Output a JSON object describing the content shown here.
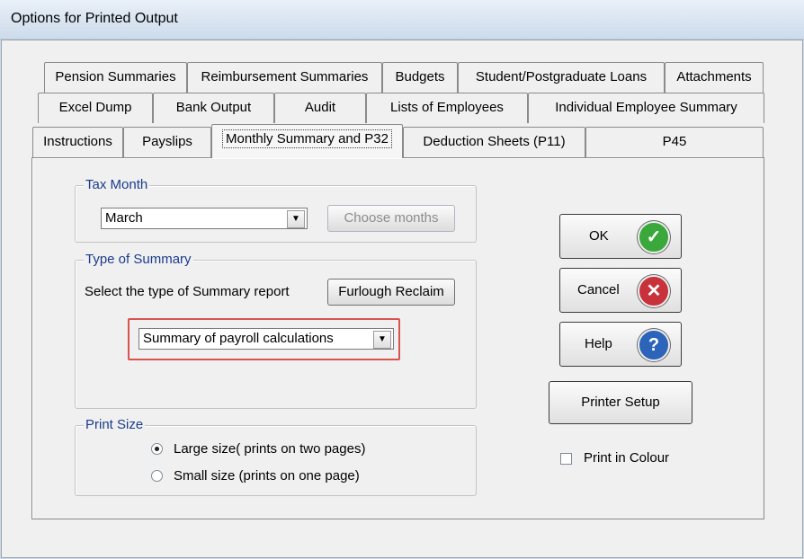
{
  "window": {
    "title": "Options for Printed Output"
  },
  "tabs": {
    "row1": [
      "Pension Summaries",
      "Reimbursement Summaries",
      "Budgets",
      "Student/Postgraduate Loans",
      "Attachments"
    ],
    "row2": [
      "Excel Dump",
      "Bank Output",
      "Audit",
      "Lists of Employees",
      "Individual Employee Summary"
    ],
    "row3": [
      "Instructions",
      "Payslips",
      "Monthly Summary and P32",
      "Deduction Sheets (P11)",
      "P45"
    ],
    "active": "Monthly Summary and P32"
  },
  "tax_month": {
    "legend": "Tax Month",
    "selected": "March",
    "choose_months_label": "Choose months"
  },
  "type_of_summary": {
    "legend": "Type of Summary",
    "prompt": "Select the type of Summary report",
    "furlough_label": "Furlough Reclaim",
    "selected": "Summary of payroll calculations"
  },
  "print_size": {
    "legend": "Print Size",
    "options": [
      "Large size( prints on two pages)",
      "Small size (prints on one page)"
    ],
    "selected_index": 0
  },
  "buttons": {
    "ok": "OK",
    "cancel": "Cancel",
    "help": "Help",
    "printer_setup": "Printer Setup"
  },
  "print_in_colour": {
    "label": "Print in Colour",
    "checked": false
  },
  "colors": {
    "ok": "#3aa83a",
    "cancel": "#c8323a",
    "help": "#2b64b8",
    "highlight": "#d9534f",
    "legend_text": "#1a3c8c"
  }
}
